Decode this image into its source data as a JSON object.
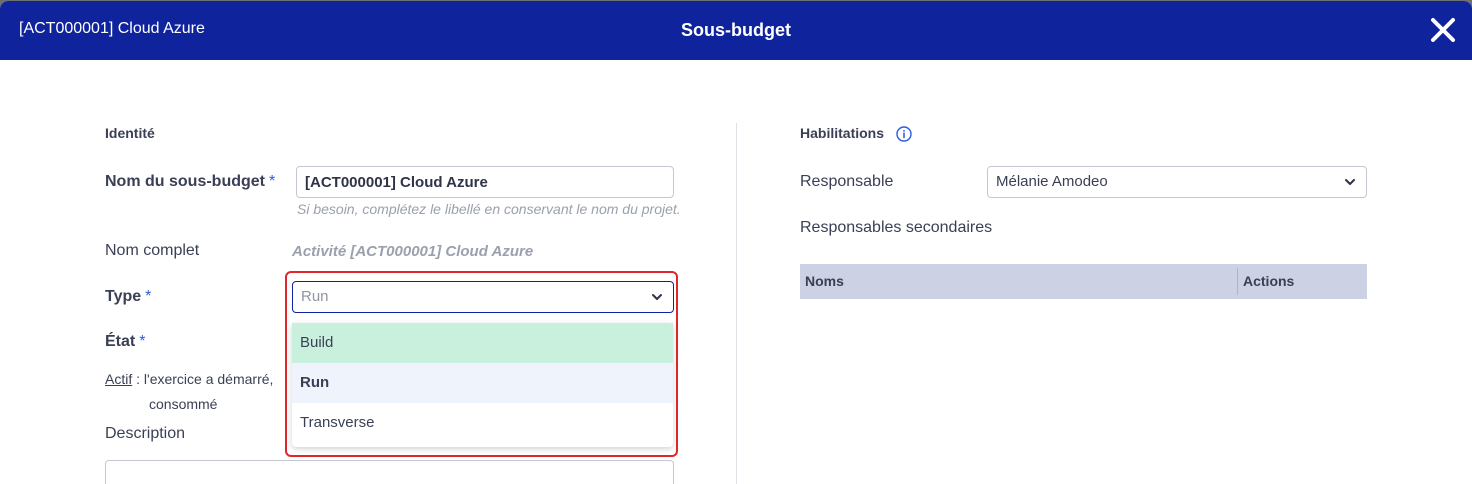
{
  "header": {
    "breadcrumb": "[ACT000001] Cloud Azure",
    "title": "Sous-budget",
    "close_icon": "close-icon"
  },
  "identity": {
    "section_title": "Identité",
    "name_label": "Nom du sous-budget",
    "required_mark": "*",
    "name_value": "[ACT000001] Cloud Azure",
    "name_hint": "Si besoin, complétez le libellé en conservant le nom du projet.",
    "fullname_label": "Nom complet",
    "fullname_value": "Activité [ACT000001] Cloud Azure",
    "type_label": "Type",
    "type_value": "Run",
    "type_options": [
      "Build",
      "Run",
      "Transverse"
    ],
    "etat_label": "État",
    "etat_link": "Actif",
    "etat_text_1": ": l'exercice a démarré,",
    "etat_text_2": "consommé",
    "description_label": "Description"
  },
  "permissions": {
    "section_title": "Habilitations",
    "responsable_label": "Responsable",
    "responsable_value": "Mélanie Amodeo",
    "secondary_label": "Responsables secondaires",
    "table_headers": {
      "names": "Noms",
      "actions": "Actions"
    }
  },
  "colors": {
    "header_bg": "#0f239c",
    "accent": "#2b5cd9",
    "highlight_border": "#e0262d",
    "hover_option": "#c8f0dd",
    "table_header_bg": "#ccd1e4"
  }
}
